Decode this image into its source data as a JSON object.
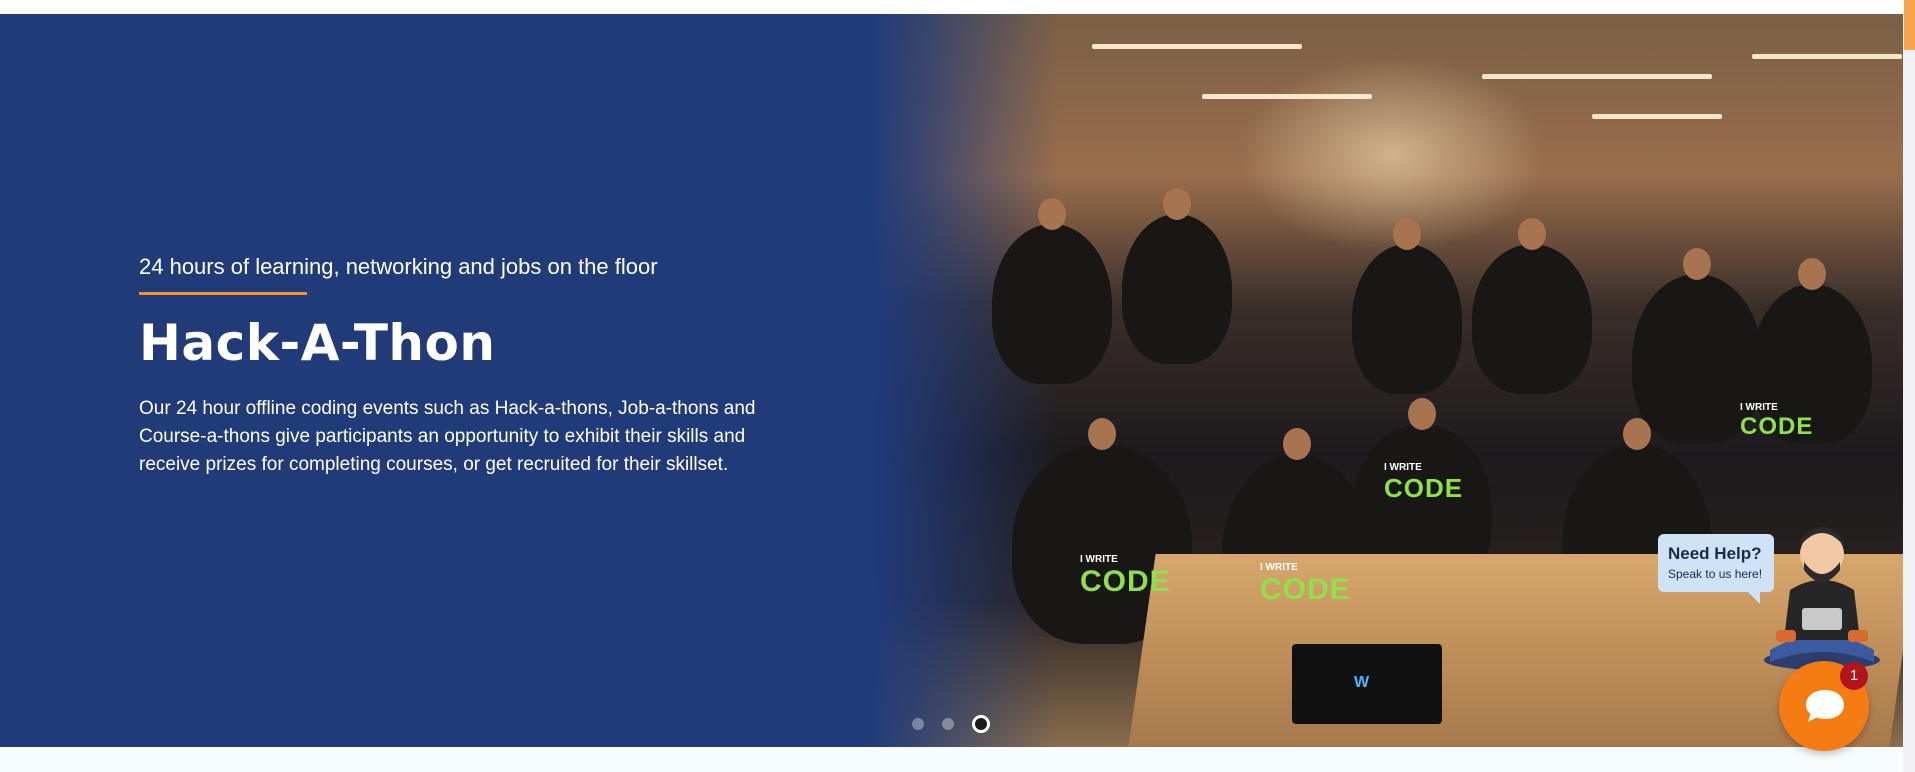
{
  "hero": {
    "tagline": "24 hours of learning, networking and jobs on the floor",
    "title": "Hack-A-Thon",
    "description": "Our 24 hour offline coding events such as Hack-a-thons, Job-a-thons and Course-a-thons give participants an opportunity to exhibit their skills and receive prizes for completing courses, or get recruited for their skillset.",
    "background_color": "#213b79",
    "accent_color": "#f4912b"
  },
  "photo": {
    "shirt_lines": [
      "I WRITE",
      "CODE"
    ]
  },
  "carousel": {
    "slide_count": 3,
    "active_index": 2
  },
  "help_widget": {
    "title": "Need Help?",
    "subtitle": "Speak to us here!",
    "unread_count": "1",
    "launcher_color": "#f57c12"
  }
}
